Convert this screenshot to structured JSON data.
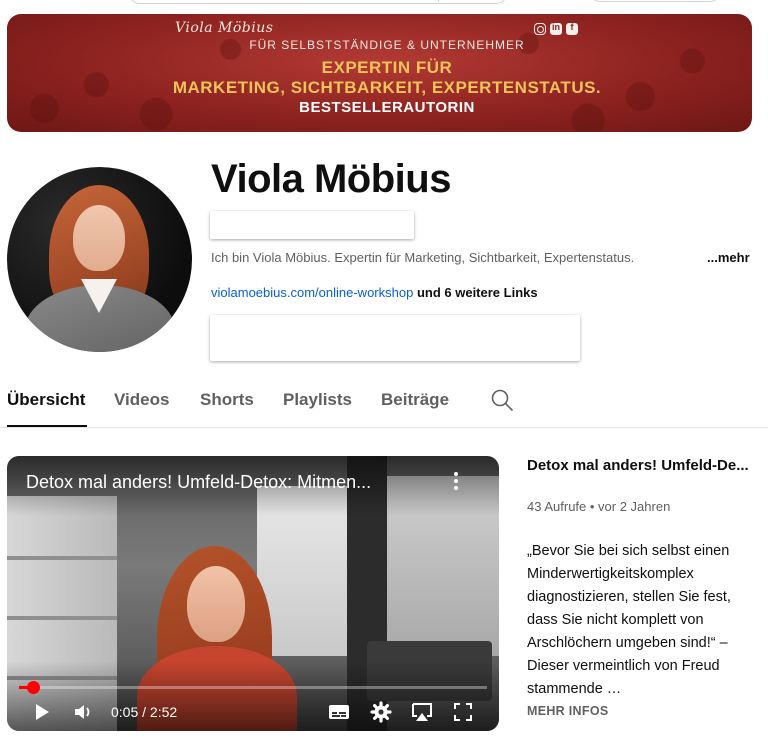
{
  "banner": {
    "logo": "Viola Möbius",
    "subtitle": "FÜR SELBSTSTÄNDIGE & UNTERNEHMER",
    "line1": "EXPERTIN FÜR",
    "line2": "MARKETING, SICHTBARKEIT, EXPERTENSTATUS.",
    "line3": "BESTSELLERAUTORIN",
    "social_icons": [
      "instagram-icon",
      "linkedin-icon",
      "facebook-icon"
    ],
    "linkedin_glyph": "in",
    "facebook_glyph": "f",
    "colors": {
      "background": "#8e2320",
      "gold": "#f0c45a"
    }
  },
  "channel": {
    "name": "Viola Möbius",
    "description": "Ich bin Viola Möbius. Expertin für Marketing, Sichtbarkeit, Expertenstatus.",
    "more_label": "...mehr",
    "link_text": "violamoebius.com/online-workshop",
    "extra_links": "und 6 weitere Links"
  },
  "tabs": [
    {
      "label": "Übersicht",
      "active": true
    },
    {
      "label": "Videos",
      "active": false
    },
    {
      "label": "Shorts",
      "active": false
    },
    {
      "label": "Playlists",
      "active": false
    },
    {
      "label": "Beiträge",
      "active": false
    }
  ],
  "player": {
    "title": "Detox mal anders! Umfeld-Detox: Mitmen...",
    "time": "0:05 / 2:52",
    "progress_fraction": 0.029,
    "accent": "#ff0000"
  },
  "featured_video": {
    "title": "Detox mal anders! Umfeld-De...",
    "meta": "43 Aufrufe • vor 2 Jahren",
    "description": "„Bevor Sie bei sich selbst einen Minderwertigkeitskomplex diagnostizieren, stellen Sie fest, dass Sie nicht komplett von Arschlöchern umgeben sind!“ – Dieser vermeintlich von Freud stammende …",
    "more_label": "MEHR INFOS"
  }
}
